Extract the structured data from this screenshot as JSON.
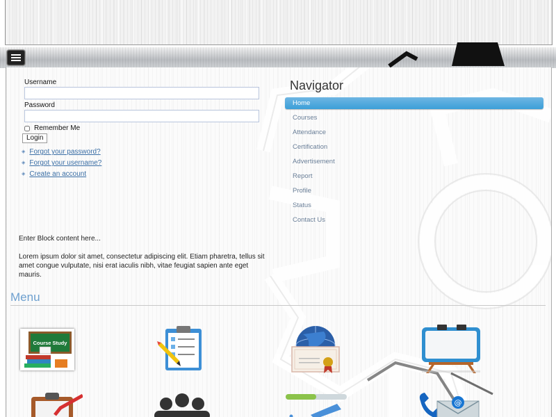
{
  "login": {
    "username_label": "Username",
    "password_label": "Password",
    "remember_label": "Remember Me",
    "login_button": "Login",
    "links": [
      "Forgot your password?",
      "Forgot your username?",
      "Create an account"
    ]
  },
  "block": {
    "intro": "Enter Block content here...",
    "lorem": "Lorem ipsum dolor sit amet, consectetur adipiscing elit. Etiam pharetra, tellus sit amet congue vulputate, nisi erat iaculis nibh, vitae feugiat sapien ante eget mauris."
  },
  "navigator": {
    "title": "Navigator",
    "items": [
      "Home",
      "Courses",
      "Attendance",
      "Certification",
      "Advertisement",
      "Report",
      "Profile",
      "Status",
      "Contact Us"
    ],
    "active": "Home"
  },
  "menu": {
    "title": "Menu",
    "course_board_text": "Course Study",
    "icons": [
      "course-study-icon",
      "clipboard-checklist-icon",
      "certificate-icon",
      "whiteboard-icon",
      "task-clipboard-icon",
      "people-group-icon",
      "progress-bar-icon",
      "contact-phone-email-icon"
    ]
  },
  "colors": {
    "accent": "#3c9fd8",
    "menu_title": "#6ea0cf",
    "link": "#3a6ea5",
    "nav_text": "#6a7f98"
  }
}
